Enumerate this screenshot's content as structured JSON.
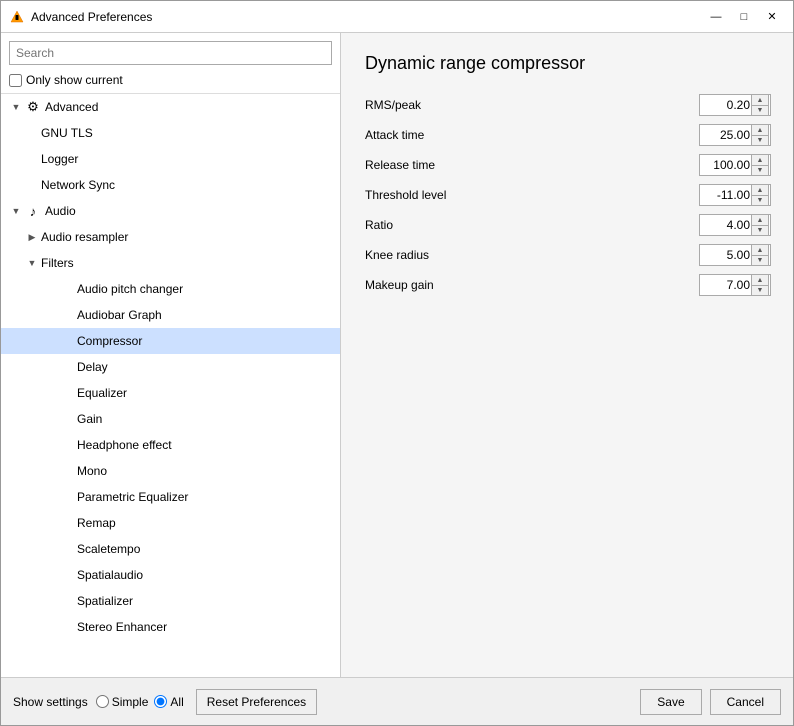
{
  "window": {
    "title": "Advanced Preferences",
    "controls": {
      "minimize": "—",
      "maximize": "□",
      "close": "✕"
    }
  },
  "left_panel": {
    "search_placeholder": "Search",
    "only_show_current_label": "Only show current",
    "tree": [
      {
        "id": "advanced",
        "label": "Advanced",
        "level": 0,
        "expanded": true,
        "icon": "⚙",
        "has_expand": true
      },
      {
        "id": "gnu_tls",
        "label": "GNU TLS",
        "level": 1,
        "expanded": false,
        "icon": "",
        "has_expand": false
      },
      {
        "id": "logger",
        "label": "Logger",
        "level": 1,
        "expanded": false,
        "icon": "",
        "has_expand": false
      },
      {
        "id": "network_sync",
        "label": "Network Sync",
        "level": 1,
        "expanded": false,
        "icon": "",
        "has_expand": false
      },
      {
        "id": "audio",
        "label": "Audio",
        "level": 0,
        "expanded": true,
        "icon": "♪",
        "has_expand": true
      },
      {
        "id": "audio_resampler",
        "label": "Audio resampler",
        "level": 1,
        "expanded": false,
        "icon": "",
        "has_expand": true
      },
      {
        "id": "filters",
        "label": "Filters",
        "level": 1,
        "expanded": true,
        "icon": "",
        "has_expand": true
      },
      {
        "id": "audio_pitch_changer",
        "label": "Audio pitch changer",
        "level": 2,
        "expanded": false,
        "icon": "",
        "has_expand": false
      },
      {
        "id": "audiobar_graph",
        "label": "Audiobar Graph",
        "level": 2,
        "expanded": false,
        "icon": "",
        "has_expand": false
      },
      {
        "id": "compressor",
        "label": "Compressor",
        "level": 2,
        "expanded": false,
        "icon": "",
        "has_expand": false,
        "selected": true
      },
      {
        "id": "delay",
        "label": "Delay",
        "level": 2,
        "expanded": false,
        "icon": "",
        "has_expand": false
      },
      {
        "id": "equalizer",
        "label": "Equalizer",
        "level": 2,
        "expanded": false,
        "icon": "",
        "has_expand": false
      },
      {
        "id": "gain",
        "label": "Gain",
        "level": 2,
        "expanded": false,
        "icon": "",
        "has_expand": false
      },
      {
        "id": "headphone_effect",
        "label": "Headphone effect",
        "level": 2,
        "expanded": false,
        "icon": "",
        "has_expand": false
      },
      {
        "id": "mono",
        "label": "Mono",
        "level": 2,
        "expanded": false,
        "icon": "",
        "has_expand": false
      },
      {
        "id": "parametric_equalizer",
        "label": "Parametric Equalizer",
        "level": 2,
        "expanded": false,
        "icon": "",
        "has_expand": false
      },
      {
        "id": "remap",
        "label": "Remap",
        "level": 2,
        "expanded": false,
        "icon": "",
        "has_expand": false
      },
      {
        "id": "scaletempo",
        "label": "Scaletempo",
        "level": 2,
        "expanded": false,
        "icon": "",
        "has_expand": false
      },
      {
        "id": "spatialaudio",
        "label": "Spatialaudio",
        "level": 2,
        "expanded": false,
        "icon": "",
        "has_expand": false
      },
      {
        "id": "spatializer",
        "label": "Spatializer",
        "level": 2,
        "expanded": false,
        "icon": "",
        "has_expand": false
      },
      {
        "id": "stereo_enhancer",
        "label": "Stereo Enhancer",
        "level": 2,
        "expanded": false,
        "icon": "",
        "has_expand": false
      }
    ]
  },
  "right_panel": {
    "title": "Dynamic range compressor",
    "params": [
      {
        "label": "RMS/peak",
        "value": "0.20"
      },
      {
        "label": "Attack time",
        "value": "25.00"
      },
      {
        "label": "Release time",
        "value": "100.00"
      },
      {
        "label": "Threshold level",
        "value": "-11.00"
      },
      {
        "label": "Ratio",
        "value": "4.00"
      },
      {
        "label": "Knee radius",
        "value": "5.00"
      },
      {
        "label": "Makeup gain",
        "value": "7.00"
      }
    ]
  },
  "bottom_bar": {
    "show_settings_label": "Show settings",
    "radio_simple": "Simple",
    "radio_all": "All",
    "reset_label": "Reset Preferences",
    "save_label": "Save",
    "cancel_label": "Cancel"
  }
}
